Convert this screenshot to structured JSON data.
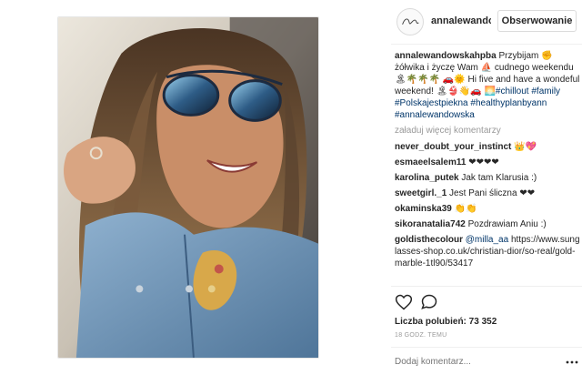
{
  "post": {
    "username": "annalewandow",
    "follow_label": "Obserwowanie"
  },
  "caption": {
    "username": "annalewandowskahpba",
    "text_1": " Przybijam ",
    "text_2": "żółwika i życzę Wam ",
    "text_3": "cudnego weekendu ",
    "text_4": " Hi five and have a wondeful weekend! ",
    "emoji_1": "✊",
    "emoji_2": "⛵",
    "emoji_3": "🏝🌴🌴🌴",
    "emoji_4": "🚗🌞",
    "emoji_5": "🏝👙👋🚗",
    "emoji_6": "🌅",
    "hashtags": [
      "#chillout",
      "#family",
      "#Polskajestpiekna",
      "#healthyplanbyann",
      "#annalewandowska"
    ]
  },
  "load_more_label": "załaduj więcej komentarzy",
  "comments": [
    {
      "user": "never_doubt_your_instinct",
      "text": "",
      "emoji": "👑💖"
    },
    {
      "user": "esmaeelsalem11",
      "text": "",
      "emoji": "❤❤❤❤"
    },
    {
      "user": "karolina_putek",
      "text": "Jak tam Klarusia :)",
      "emoji": ""
    },
    {
      "user": "sweetgirl._1",
      "text": "Jest Pani śliczna",
      "emoji": "❤❤"
    },
    {
      "user": "okaminska39",
      "text": "",
      "emoji": "👏👏"
    },
    {
      "user": "sikoranatalia742",
      "text": "Pozdrawiam Aniu :)",
      "emoji": ""
    }
  ],
  "last_comment": {
    "user": "goldisthecolour",
    "mention": "@milla_aa",
    "link": "https://www.sunglasses-shop.co.uk/christian-dior/so-real/gold-marble-1tl90/53417"
  },
  "likes_label": "Liczba polubień: 73 352",
  "time_label": "18 GODZ. TEMU",
  "add_comment_placeholder": "Dodaj komentarz...",
  "icons": {
    "like": "heart-icon",
    "comment": "comment-bubble-icon",
    "more": "more-options-icon"
  },
  "colors": {
    "hashtag": "#003569",
    "muted": "#999999",
    "border": "#dbdbdb"
  }
}
